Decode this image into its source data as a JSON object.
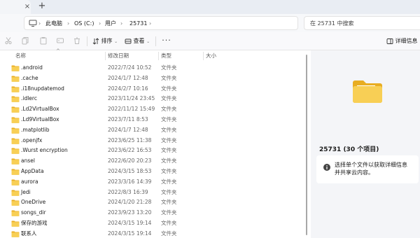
{
  "tabbar": {
    "close_glyph": "×",
    "add_glyph": "+"
  },
  "address": {
    "breadcrumbs": [
      "此电脑",
      "OS (C:)",
      "用户",
      "25731"
    ],
    "separator": "›",
    "search_placeholder": "在 25731 中搜索"
  },
  "commandbar": {
    "sort_label": "排序",
    "view_label": "查看",
    "more_glyph": "···",
    "details_label": "详细信息"
  },
  "columns": {
    "name": "名称",
    "modified": "修改日期",
    "type": "类型",
    "size": "大小"
  },
  "files": [
    {
      "name": ".android",
      "modified": "2022/7/24 10:52",
      "type": "文件夹"
    },
    {
      "name": ".cache",
      "modified": "2024/1/7 12:48",
      "type": "文件夹"
    },
    {
      "name": ".i18nupdatemod",
      "modified": "2024/2/7 10:16",
      "type": "文件夹"
    },
    {
      "name": ".idlerc",
      "modified": "2023/11/24 23:45",
      "type": "文件夹"
    },
    {
      "name": ".Ld2VirtualBox",
      "modified": "2022/11/12 15:49",
      "type": "文件夹"
    },
    {
      "name": ".Ld9VirtualBox",
      "modified": "2023/7/11 8:53",
      "type": "文件夹"
    },
    {
      "name": ".matplotlib",
      "modified": "2024/1/7 12:48",
      "type": "文件夹"
    },
    {
      "name": ".openjfx",
      "modified": "2023/6/25 11:38",
      "type": "文件夹"
    },
    {
      "name": ".Wurst encryption",
      "modified": "2023/6/22 16:53",
      "type": "文件夹"
    },
    {
      "name": "ansel",
      "modified": "2022/6/20 20:23",
      "type": "文件夹"
    },
    {
      "name": "AppData",
      "modified": "2024/3/15 18:53",
      "type": "文件夹"
    },
    {
      "name": "aurora",
      "modified": "2023/3/16 14:39",
      "type": "文件夹"
    },
    {
      "name": "Jedi",
      "modified": "2022/8/3 16:39",
      "type": "文件夹"
    },
    {
      "name": "OneDrive",
      "modified": "2024/1/20 21:28",
      "type": "文件夹"
    },
    {
      "name": "songs_dir",
      "modified": "2023/9/23 13:20",
      "type": "文件夹"
    },
    {
      "name": "保存的游戏",
      "modified": "2024/3/15 19:14",
      "type": "文件夹"
    },
    {
      "name": "联系人",
      "modified": "2024/3/15 19:14",
      "type": "文件夹"
    }
  ],
  "details": {
    "title": "25731 (30 个项目)",
    "info_text": "选择单个文件以获取详细信息并共享云内容。"
  },
  "colors": {
    "folder": "#f5c542",
    "folder_dark": "#e8ad22",
    "accent": "#0067c0"
  }
}
